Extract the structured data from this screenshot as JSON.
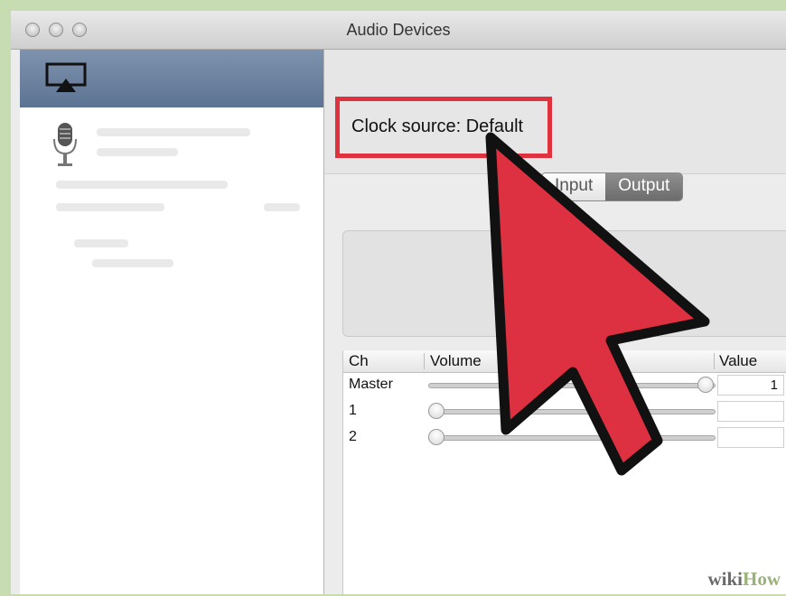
{
  "window": {
    "title": "Audio Devices"
  },
  "sidebar": {
    "selected_icon": "airplay-icon",
    "items": [
      {
        "icon": "microphone-icon"
      }
    ]
  },
  "clock": {
    "text": "Clock source: Default"
  },
  "tabs": [
    {
      "label": "Input",
      "active": false
    },
    {
      "label": "Output",
      "active": true
    }
  ],
  "table": {
    "headers": {
      "ch": "Ch",
      "volume": "Volume",
      "value": "Value"
    },
    "rows": [
      {
        "label": "Master",
        "level": 1.0,
        "value": "1"
      },
      {
        "label": "1",
        "level": 0.0,
        "value": ""
      },
      {
        "label": "2",
        "level": 0.0,
        "value": ""
      }
    ]
  },
  "watermark": {
    "wiki": "wiki",
    "how": "How"
  },
  "colors": {
    "highlight": "#e0313f",
    "cursor": "#dd3040",
    "selection": "#6a7f9c"
  }
}
